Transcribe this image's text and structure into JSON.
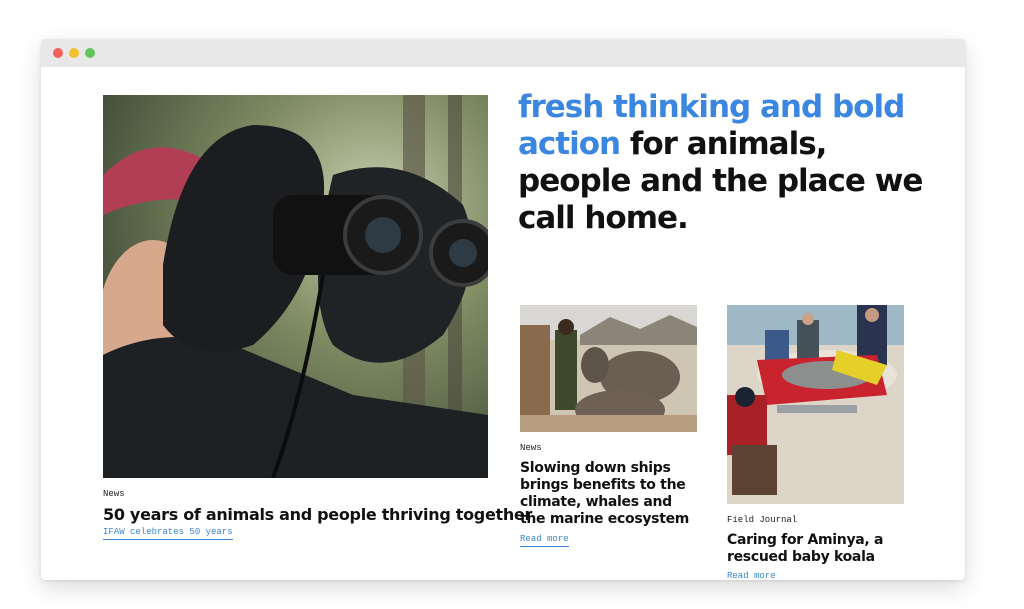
{
  "window": {
    "controls": [
      "close",
      "minimize",
      "maximize"
    ]
  },
  "hero": {
    "image_icon": "photo-woman-binoculars",
    "kicker": "News",
    "headline": "50 years of animals and people thriving together",
    "link": "IFAW celebrates 50 years"
  },
  "tagline": {
    "accent": "fresh thinking and bold action",
    "rest": " for animals, people and the place we call home."
  },
  "cards": [
    {
      "image_icon": "photo-elephants",
      "kicker": "News",
      "headline": "Slowing down ships brings benefits to the climate, whales and the marine ecosystem",
      "link": "Read more"
    },
    {
      "image_icon": "photo-dolphin-rescue",
      "kicker": "Field Journal",
      "headline": "Caring for Aminya, a rescued baby koala",
      "link": "Read more"
    }
  ],
  "colors": {
    "accent": "#3a86e0",
    "text": "#111111",
    "link": "#3a86d8"
  }
}
